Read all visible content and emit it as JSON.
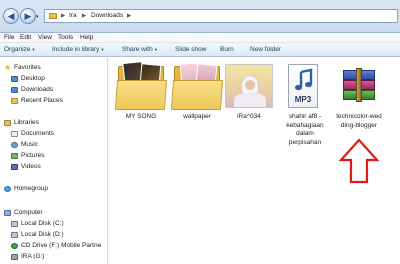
{
  "window": {
    "title": "Downloads"
  },
  "address_bar": {
    "back_glyph": "◀",
    "forward_glyph": "▶",
    "dropdown_glyph": "▾",
    "separator": "▶",
    "breadcrumbs": [
      "Ira",
      "Downloads"
    ]
  },
  "menu": [
    "File",
    "Edit",
    "View",
    "Tools",
    "Help"
  ],
  "command_bar": {
    "organize": "Organize",
    "include_in_library": "Include in library",
    "share_with": "Share with",
    "slide_show": "Slide show",
    "burn": "Burn",
    "new_folder": "New folder",
    "caret": "▾"
  },
  "nav_pane": {
    "favorites": "Favorites",
    "favorite_items": [
      "Desktop",
      "Downloads",
      "Recent Places"
    ],
    "libraries": "Libraries",
    "library_items": [
      "Documents",
      "Music",
      "Pictures",
      "Videos"
    ],
    "homegroup": "Homegroup",
    "computer": "Computer",
    "computer_items": [
      "Local Disk (C:)",
      "Local Disk (D:)",
      "CD Drive (F:) Mobile Partne",
      "IRA (G:)"
    ]
  },
  "files": [
    {
      "name": "MY SONG",
      "icon": "folder-icon"
    },
    {
      "name": "wallpaper",
      "icon": "folder-icon"
    },
    {
      "name": "iRa^034",
      "icon": "photo-thumbnail"
    },
    {
      "name": "shahir af8 -\nkebahagiaan\ndalam\nperpisahan",
      "icon": "mp3-file-icon",
      "badge": "MP3"
    },
    {
      "name": "technicolor-wed\nding-blogger",
      "icon": "winrar-archive-icon"
    }
  ],
  "colors": {
    "annotation_arrow": "#e01a1a",
    "folder_yellow": "#f0c85a"
  }
}
